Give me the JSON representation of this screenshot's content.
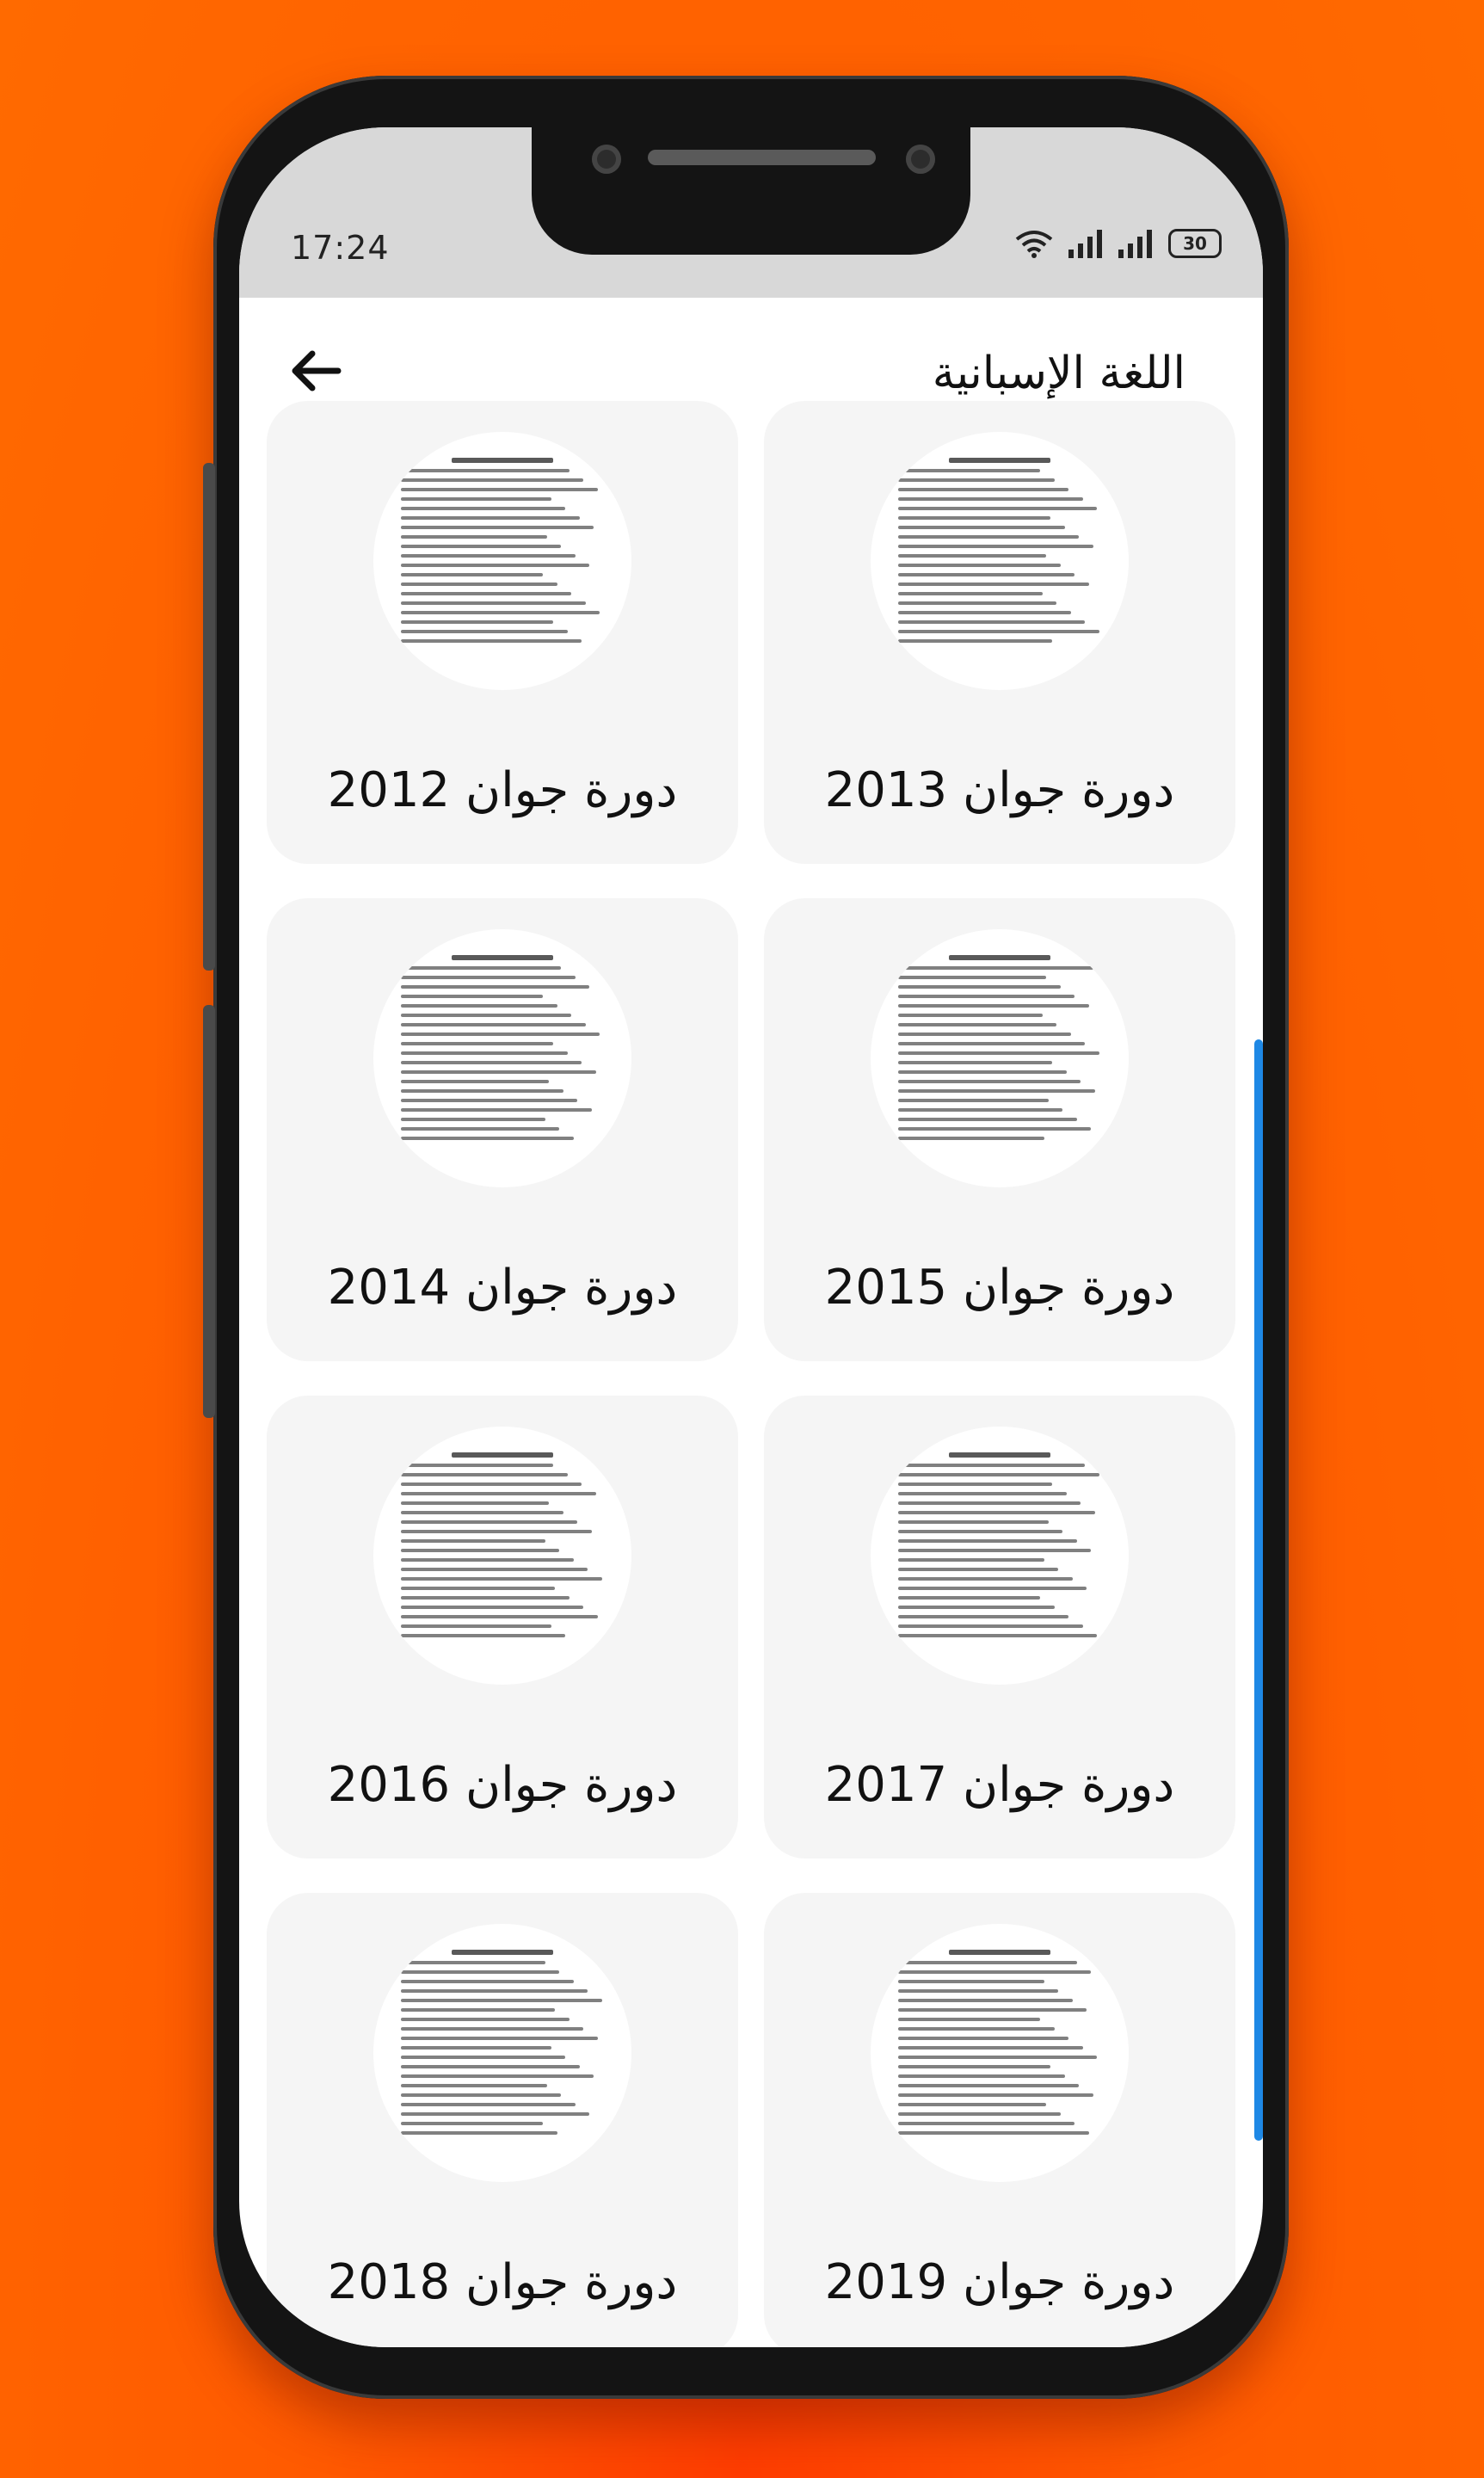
{
  "status_bar": {
    "time": "17:24",
    "battery": "30",
    "icons": [
      "wifi-icon",
      "signal-icon",
      "signal-icon",
      "battery-icon"
    ]
  },
  "header": {
    "title": "اللغة الإسبانية",
    "back_icon": "arrow-left-icon"
  },
  "cards": [
    {
      "label": "دورة جوان 2013",
      "icon": "document-thumbnail"
    },
    {
      "label": "دورة جوان 2012",
      "icon": "document-thumbnail"
    },
    {
      "label": "دورة جوان 2015",
      "icon": "document-thumbnail"
    },
    {
      "label": "دورة جوان 2014",
      "icon": "document-thumbnail"
    },
    {
      "label": "دورة جوان 2017",
      "icon": "document-thumbnail"
    },
    {
      "label": "دورة جوان 2016",
      "icon": "document-thumbnail"
    },
    {
      "label": "دورة جوان 2019",
      "icon": "document-thumbnail"
    },
    {
      "label": "دورة جوان 2018",
      "icon": "document-thumbnail"
    }
  ],
  "colors": {
    "background": "#ff6a00",
    "accent": "#1e88e5",
    "card": "#f5f5f5"
  }
}
